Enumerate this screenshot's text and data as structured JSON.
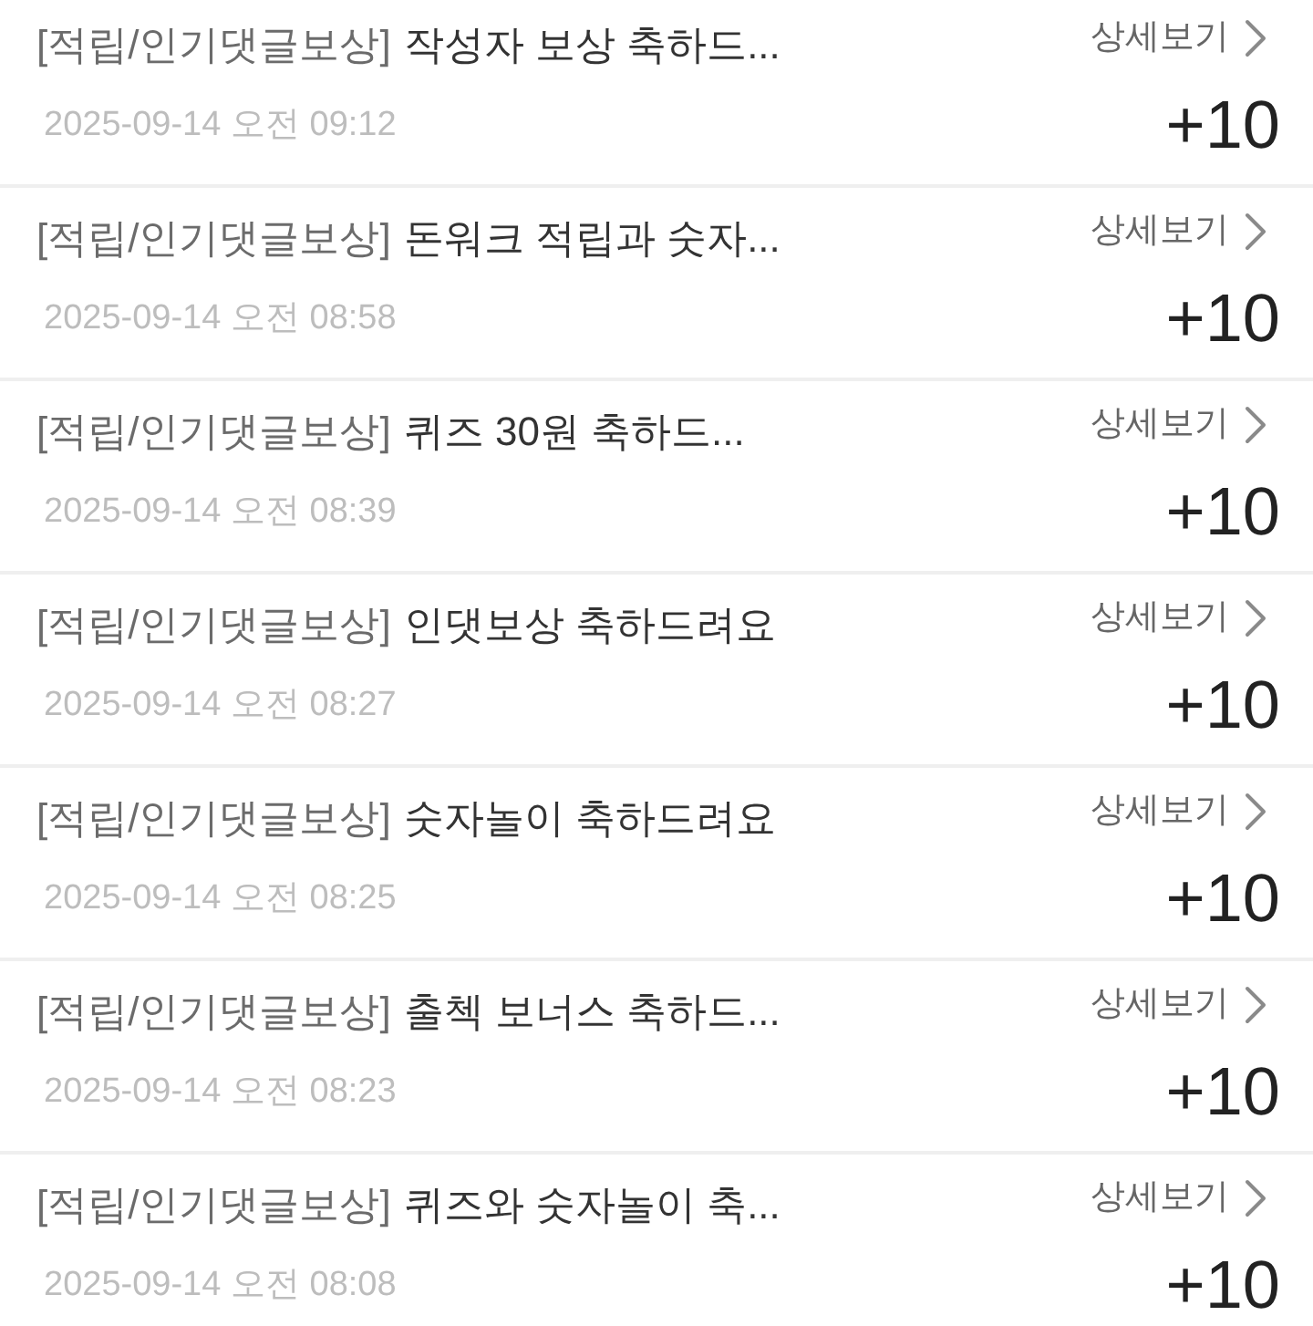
{
  "items": [
    {
      "category": "[적립/인기댓글보상]",
      "title": "작성자 보상 축하드...",
      "date": "2025-09-14 오전 09:12",
      "detail_link": "상세보기",
      "points": "+10"
    },
    {
      "category": "[적립/인기댓글보상]",
      "title": "돈워크 적립과 숫자...",
      "date": "2025-09-14 오전 08:58",
      "detail_link": "상세보기",
      "points": "+10"
    },
    {
      "category": "[적립/인기댓글보상]",
      "title": "퀴즈 30원 축하드...",
      "date": "2025-09-14 오전 08:39",
      "detail_link": "상세보기",
      "points": "+10"
    },
    {
      "category": "[적립/인기댓글보상]",
      "title": "인댓보상 축하드려요",
      "date": "2025-09-14 오전 08:27",
      "detail_link": "상세보기",
      "points": "+10"
    },
    {
      "category": "[적립/인기댓글보상]",
      "title": "숫자놀이 축하드려요",
      "date": "2025-09-14 오전 08:25",
      "detail_link": "상세보기",
      "points": "+10"
    },
    {
      "category": "[적립/인기댓글보상]",
      "title": "출첵 보너스 축하드...",
      "date": "2025-09-14 오전 08:23",
      "detail_link": "상세보기",
      "points": "+10"
    },
    {
      "category": "[적립/인기댓글보상]",
      "title": "퀴즈와 숫자놀이 축...",
      "date": "2025-09-14 오전 08:08",
      "detail_link": "상세보기",
      "points": "+10"
    }
  ]
}
